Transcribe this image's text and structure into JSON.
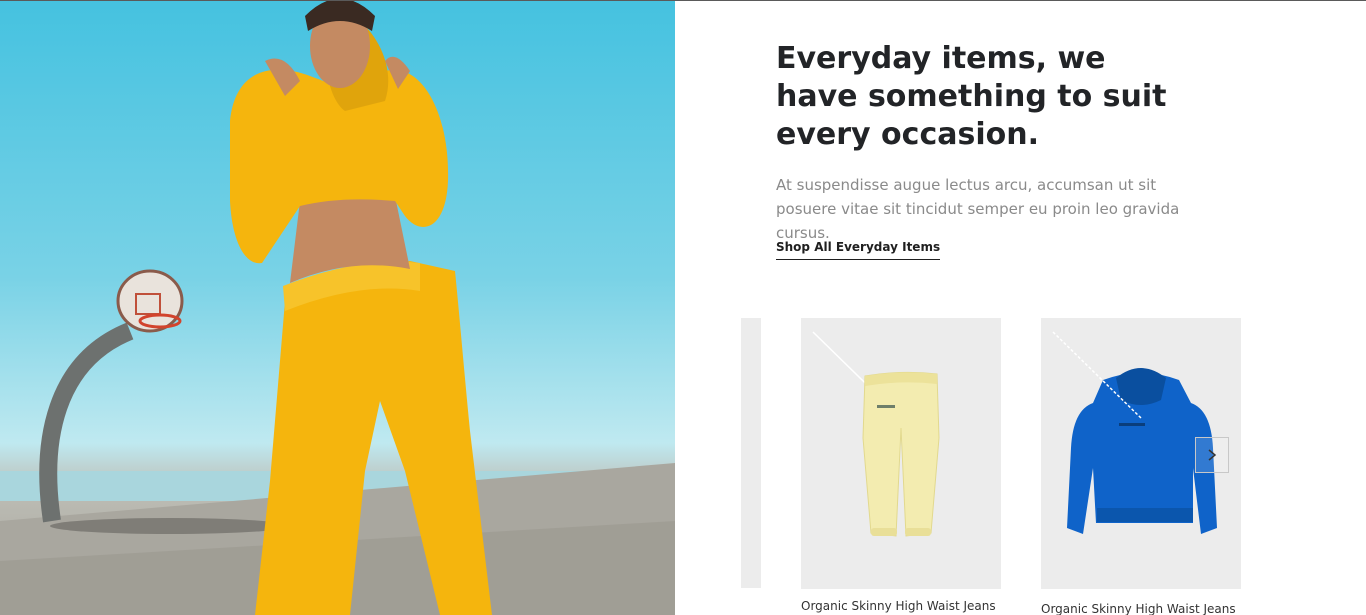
{
  "hero": {
    "image": "woman in yellow tracksuit on basketball court"
  },
  "section": {
    "heading": "Everyday items, we have something to suit every occasion.",
    "description": "At suspendisse augue lectus arcu, accumsan ut sit posuere vitae sit tincidut semper eu proin leo gravida cursus.",
    "link_label": "Shop All Everyday Items"
  },
  "products": [
    {
      "name": "Organic Skinny High Waist Jeans",
      "image": "pale yellow sweatpants"
    },
    {
      "name": "Organic Skinny High Waist Jeans",
      "image": "blue hoodie"
    }
  ],
  "carousel": {
    "next_icon": "chevron-right-icon"
  },
  "colors": {
    "heading": "#222427",
    "body_text": "#8a8a8a",
    "card_bg": "#ececec",
    "hoodie_blue": "#0f63c9",
    "pants_yellow": "#f3ecb0",
    "tracksuit_yellow": "#f5b50d"
  }
}
